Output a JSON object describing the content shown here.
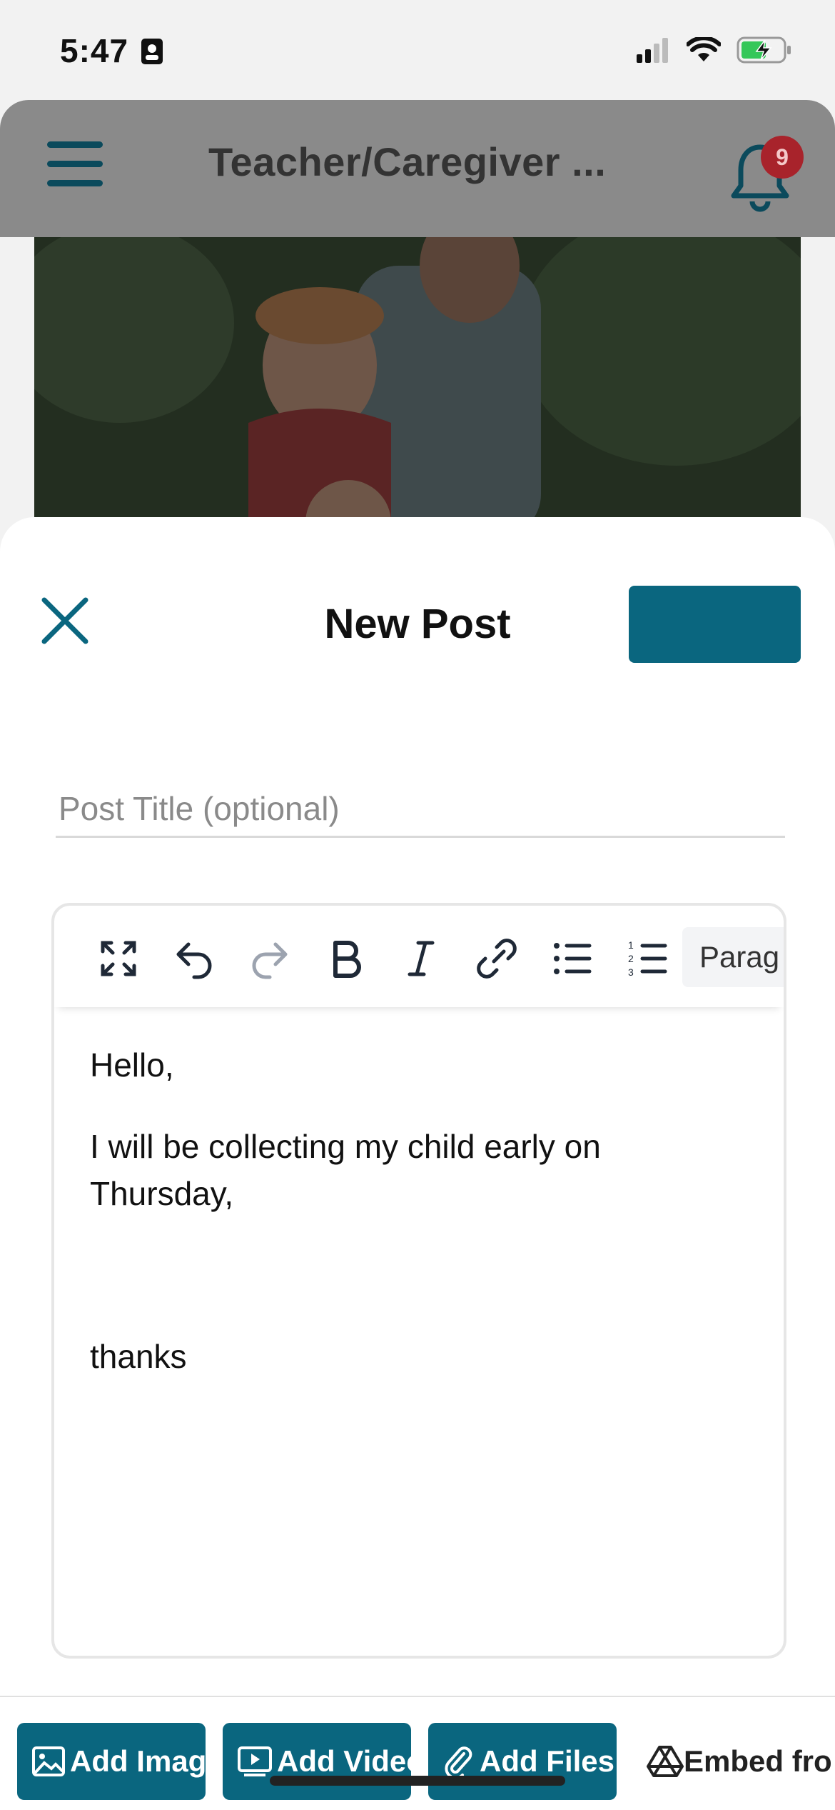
{
  "status_bar": {
    "time": "5:47"
  },
  "app": {
    "title": "Teacher/Caregiver ...",
    "notifications_count": "9"
  },
  "sheet": {
    "title": "New Post",
    "post_button_label": ""
  },
  "title_field": {
    "placeholder": "Post Title (optional)",
    "value": ""
  },
  "toolbar": {
    "tools": [
      "fullscreen-icon",
      "undo-icon",
      "redo-icon",
      "bold-icon",
      "italic-icon",
      "link-icon",
      "bullet-list-icon",
      "numbered-list-icon"
    ],
    "format_selected": "Parag"
  },
  "editor": {
    "paragraphs": [
      "Hello,",
      "I will be collecting my child early on Thursday,",
      "",
      "thanks"
    ]
  },
  "attachments": {
    "add_image": "Add Imag",
    "add_video": "Add Video",
    "add_files": "Add Files",
    "embed": "Embed fro"
  },
  "colors": {
    "accent": "#0a667f",
    "badge": "#a8232b"
  }
}
